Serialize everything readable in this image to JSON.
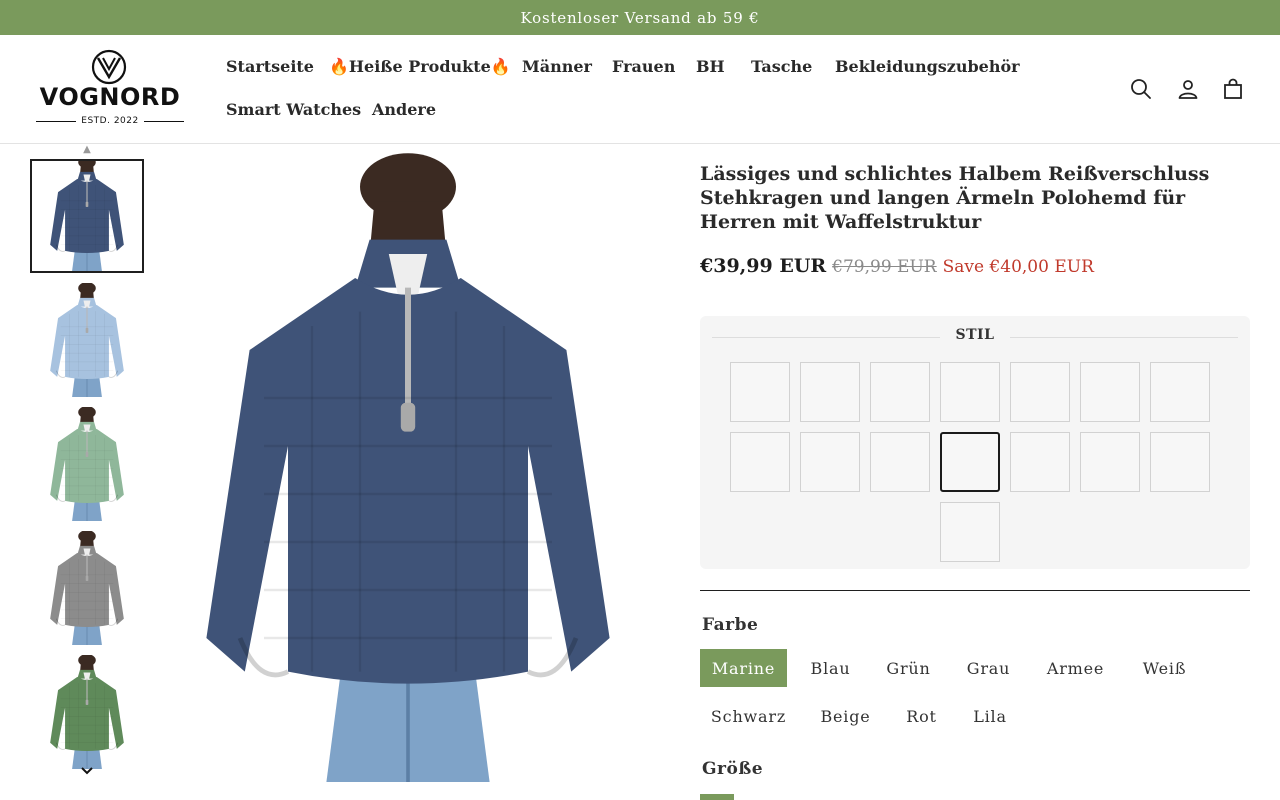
{
  "announcement": {
    "text": "Kostenloser Versand ab 59 €"
  },
  "brand": {
    "name": "VOGNORD",
    "tagline": "ESTD. 2022"
  },
  "nav": {
    "items": [
      {
        "label": "Startseite"
      },
      {
        "label": "🔥Heiße Produkte🔥"
      },
      {
        "label": "Männer"
      },
      {
        "label": "Frauen"
      },
      {
        "label": "BH"
      },
      {
        "label": "Tasche"
      },
      {
        "label": "Bekleidungszubehör"
      },
      {
        "label": "Smart Watches"
      },
      {
        "label": "Andere"
      }
    ]
  },
  "header_icons": [
    "search-icon",
    "account-icon",
    "cart-icon"
  ],
  "gallery": {
    "thumbnail_colors": [
      "#3f5378",
      "#a7c2df",
      "#8fb79a",
      "#8c8c8c",
      "#5f8a5a"
    ],
    "active_index": 0,
    "main_color": "#3f5378"
  },
  "product": {
    "title": "Lässiges und schlichtes Halbem Reißverschluss Stehkragen und langen Ärmeln Polohemd für Herren mit Waffelstruktur",
    "price": "€39,99 EUR",
    "compare_price": "€79,99 EUR",
    "savings": "Save €40,00 EUR"
  },
  "style_picker": {
    "label": "STIL",
    "count": 15,
    "selected_index": 10
  },
  "color_picker": {
    "label": "Farbe",
    "options": [
      "Marine",
      "Blau",
      "Grün",
      "Grau",
      "Armee",
      "Weiß",
      "Schwarz",
      "Beige",
      "Rot",
      "Lila"
    ],
    "selected": "Marine"
  },
  "size_picker": {
    "label": "Größe"
  },
  "colors": {
    "accent": "#7a9a5c",
    "sale": "#c0392b",
    "text": "#222222"
  }
}
